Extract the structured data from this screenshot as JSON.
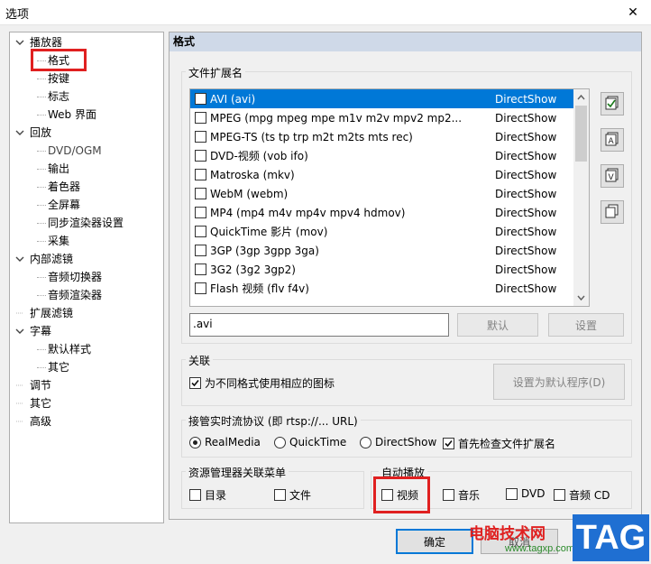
{
  "window": {
    "title": "选项",
    "close_symbol": "✕"
  },
  "tree": {
    "items": [
      {
        "label": "播放器",
        "level": 0,
        "expanded": true
      },
      {
        "label": "格式",
        "level": 1,
        "selected": true
      },
      {
        "label": "按键",
        "level": 1
      },
      {
        "label": "标志",
        "level": 1
      },
      {
        "label": "Web 界面",
        "level": 1
      },
      {
        "label": "回放",
        "level": 0,
        "expanded": true
      },
      {
        "label": "DVD/OGM",
        "level": 1,
        "muted": true
      },
      {
        "label": "输出",
        "level": 1
      },
      {
        "label": "着色器",
        "level": 1
      },
      {
        "label": "全屏幕",
        "level": 1
      },
      {
        "label": "同步渲染器设置",
        "level": 1
      },
      {
        "label": "采集",
        "level": 1
      },
      {
        "label": "内部滤镜",
        "level": 0,
        "expanded": true
      },
      {
        "label": "音频切换器",
        "level": 1
      },
      {
        "label": "音频渲染器",
        "level": 1
      },
      {
        "label": "扩展滤镜",
        "level": 0
      },
      {
        "label": "字幕",
        "level": 0,
        "expanded": true
      },
      {
        "label": "默认样式",
        "level": 1
      },
      {
        "label": "其它",
        "level": 1
      },
      {
        "label": "调节",
        "level": 0
      },
      {
        "label": "其它",
        "level": 0
      },
      {
        "label": "高级",
        "level": 0
      }
    ]
  },
  "panel": {
    "header": "格式",
    "ext_group": {
      "label": "文件扩展名",
      "rows": [
        {
          "name": "AVI (avi)",
          "filter": "DirectShow",
          "selected": true
        },
        {
          "name": "MPEG (mpg mpeg mpe m1v m2v mpv2 mp2...",
          "filter": "DirectShow"
        },
        {
          "name": "MPEG-TS (ts tp trp m2t m2ts mts rec)",
          "filter": "DirectShow"
        },
        {
          "name": "DVD-视频 (vob ifo)",
          "filter": "DirectShow"
        },
        {
          "name": "Matroska (mkv)",
          "filter": "DirectShow"
        },
        {
          "name": "WebM (webm)",
          "filter": "DirectShow"
        },
        {
          "name": "MP4 (mp4 m4v mp4v mpv4 hdmov)",
          "filter": "DirectShow"
        },
        {
          "name": "QuickTime 影片 (mov)",
          "filter": "DirectShow"
        },
        {
          "name": "3GP (3gp 3gpp 3ga)",
          "filter": "DirectShow"
        },
        {
          "name": "3G2 (3g2 3gp2)",
          "filter": "DirectShow"
        },
        {
          "name": "Flash 视频 (flv f4v)",
          "filter": "DirectShow"
        }
      ],
      "side_buttons": [
        "select-all-icon",
        "audio-icon",
        "video-icon",
        "copy-icon"
      ],
      "side_button_letters": [
        "",
        "A",
        "V",
        ""
      ],
      "ext_value": ".avi",
      "default_label": "默认",
      "settings_label": "设置"
    },
    "assoc_group": {
      "label": "关联",
      "checkbox_label": "为不同格式使用相应的图标",
      "checkbox_checked": true,
      "set_default_label": "设置为默认程序(D)"
    },
    "rtsp_group": {
      "label": "接管实时流协议 (即 rtsp://... URL)",
      "radios": [
        {
          "label": "RealMedia",
          "checked": true
        },
        {
          "label": "QuickTime",
          "checked": false
        },
        {
          "label": "DirectShow",
          "checked": false
        }
      ],
      "check_ext_label": "首先检查文件扩展名",
      "check_ext_checked": true
    },
    "explorer_group": {
      "label": "资源管理器关联菜单",
      "items": [
        {
          "label": "目录",
          "checked": false
        },
        {
          "label": "文件",
          "checked": false
        }
      ]
    },
    "autoplay_group": {
      "label": "自动播放",
      "items": [
        {
          "label": "视频",
          "checked": false
        },
        {
          "label": "音乐",
          "checked": false
        },
        {
          "label": "DVD",
          "checked": false
        },
        {
          "label": "音频 CD",
          "checked": false
        }
      ]
    }
  },
  "footer": {
    "ok_label": "确定",
    "cancel_label": "取消"
  },
  "watermark": {
    "cn": "电脑技术网",
    "url": "www.tagxp.com",
    "tag": "TAG"
  },
  "colors": {
    "selection": "#0078d7",
    "highlight_box": "#e02020",
    "header_bg": "#cfd9e8"
  }
}
